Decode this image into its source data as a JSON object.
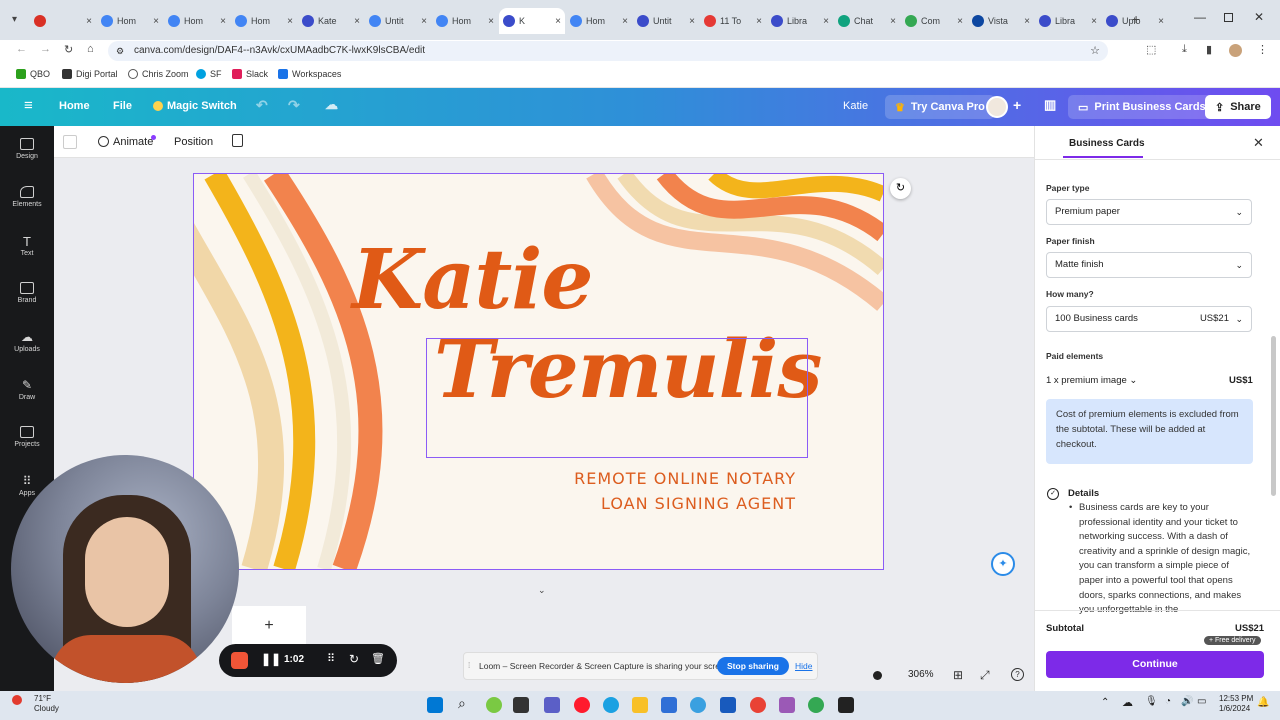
{
  "browser": {
    "tabs": [
      {
        "label": "",
        "color": "#d93025"
      },
      {
        "label": "Hom",
        "color": "#4285f4"
      },
      {
        "label": "Hom",
        "color": "#4285f4"
      },
      {
        "label": "Hom",
        "color": "#4285f4"
      },
      {
        "label": "Kate",
        "color": "#3b4cca"
      },
      {
        "label": "Untit",
        "color": "#4285f4"
      },
      {
        "label": "Hom",
        "color": "#4285f4"
      },
      {
        "label": "K",
        "color": "#3b4cca",
        "active": true
      },
      {
        "label": "Hom",
        "color": "#4285f4"
      },
      {
        "label": "Untit",
        "color": "#3b4cca"
      },
      {
        "label": "11 To",
        "color": "#e53935"
      },
      {
        "label": "Libra",
        "color": "#3b4cca"
      },
      {
        "label": "Chat",
        "color": "#10a37f"
      },
      {
        "label": "Com",
        "color": "#34a853"
      },
      {
        "label": "Vista",
        "color": "#0d47a1"
      },
      {
        "label": "Libra",
        "color": "#3b4cca"
      },
      {
        "label": "Uplo",
        "color": "#3b4cca"
      }
    ],
    "url": "canva.com/design/DAF4--n3Avk/cxUMAadbC7K-lwxK9lsCBA/edit",
    "bookmarks": [
      "QBO",
      "Digi Portal",
      "Chris Zoom",
      "SF",
      "Slack",
      "Workspaces"
    ]
  },
  "canva_bar": {
    "home": "Home",
    "file": "File",
    "magic_switch": "Magic Switch",
    "user_name": "Katie",
    "try_pro": "Try Canva Pro",
    "print": "Print Business Cards",
    "share": "Share"
  },
  "rail": [
    "Design",
    "Elements",
    "Text",
    "Brand",
    "Uploads",
    "Draw",
    "Projects",
    "Apps"
  ],
  "context_bar": {
    "animate": "Animate",
    "position": "Position"
  },
  "card": {
    "first_name": "Katie",
    "last_name": "Tremulis",
    "line1": "REMOTE ONLINE NOTARY",
    "line2": "LOAN SIGNING AGENT"
  },
  "panel": {
    "tab": "Business Cards",
    "paper_type_label": "Paper type",
    "paper_type_value": "Premium paper",
    "paper_finish_label": "Paper finish",
    "paper_finish_value": "Matte finish",
    "how_many_label": "How many?",
    "how_many_value": "100 Business cards",
    "how_many_price": "US$21",
    "paid_label": "Paid elements",
    "paid_item": "1 x premium image",
    "paid_price": "US$1",
    "note": "Cost of premium elements is excluded from the subtotal. These will be added at checkout.",
    "details_title": "Details",
    "details_text": "Business cards are key to your professional identity and your ticket to networking success. With a dash of creativity and a sprinkle of design magic, you can transform a simple piece of paper into a powerful tool that opens doors, sparks connections, and makes you unforgettable in the",
    "subtotal_label": "Subtotal",
    "subtotal_value": "US$21",
    "free_delivery": "+ Free delivery",
    "continue": "Continue"
  },
  "zoom": "306%",
  "loom": {
    "timer": "1:02",
    "share_msg": "Loom – Screen Recorder & Screen Capture is sharing your screen.",
    "stop": "Stop sharing",
    "hide": "Hide"
  },
  "taskbar": {
    "weather_temp": "71°F",
    "weather_desc": "Cloudy",
    "time": "12:53 PM",
    "date": "1/6/2024"
  }
}
